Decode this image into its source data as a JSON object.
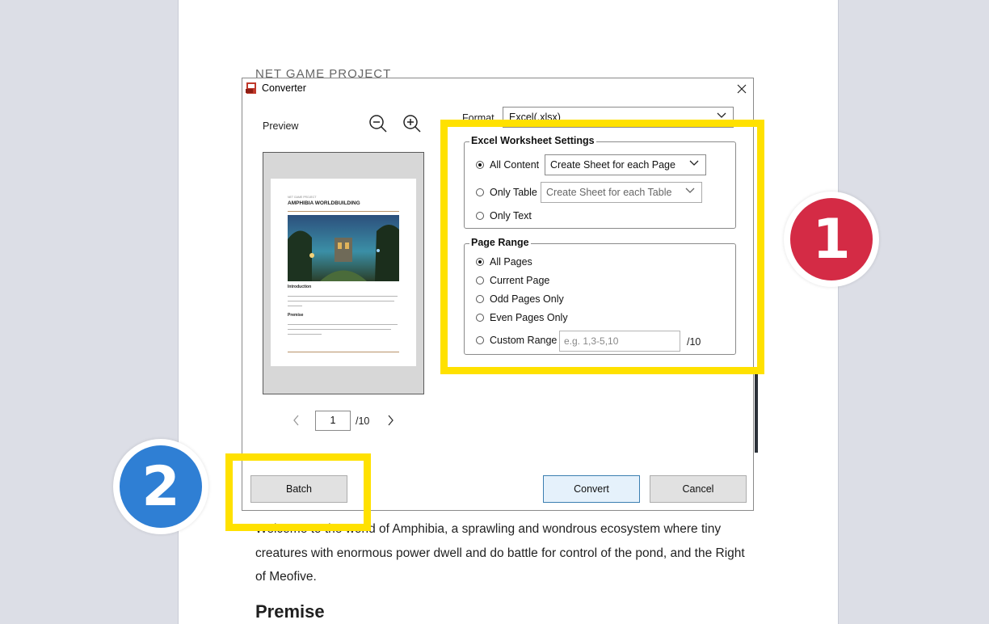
{
  "document": {
    "header": "NET GAME PROJECT",
    "body_text": "Welcome to the world of Amphibia, a sprawling and wondrous ecosystem where tiny creatures with enormous power dwell and do battle for control of the pond, and the Right of Meofive.",
    "heading": "Premise"
  },
  "dialog": {
    "title": "Converter",
    "preview_label": "Preview",
    "format_label": "Format",
    "format_value": "Excel(.xlsx)",
    "mini_page": {
      "small": "NET GAME PROJECT",
      "title": "AMPHIBIA WORLDBUILDING",
      "h1": "Introduction",
      "h2": "Premise"
    },
    "excel_group": {
      "title": "Excel Worksheet Settings",
      "all_content": "All Content",
      "all_content_option": "Create Sheet for each Page",
      "only_table": "Only Table",
      "only_table_option": "Create Sheet for each Table",
      "only_text": "Only Text"
    },
    "range_group": {
      "title": "Page Range",
      "all_pages": "All Pages",
      "current_page": "Current Page",
      "odd_pages": "Odd Pages Only",
      "even_pages": "Even Pages Only",
      "custom_range": "Custom Range",
      "custom_placeholder": "e.g. 1,3-5,10",
      "custom_total": "/10"
    },
    "pager": {
      "current": "1",
      "total": "/10"
    },
    "buttons": {
      "batch": "Batch",
      "convert": "Convert",
      "cancel": "Cancel"
    }
  },
  "overlays": {
    "badge1": "1",
    "badge2": "2",
    "badge1_color": "#d42b45",
    "badge2_color": "#2f7fd4",
    "highlight_color": "#ffe100"
  }
}
